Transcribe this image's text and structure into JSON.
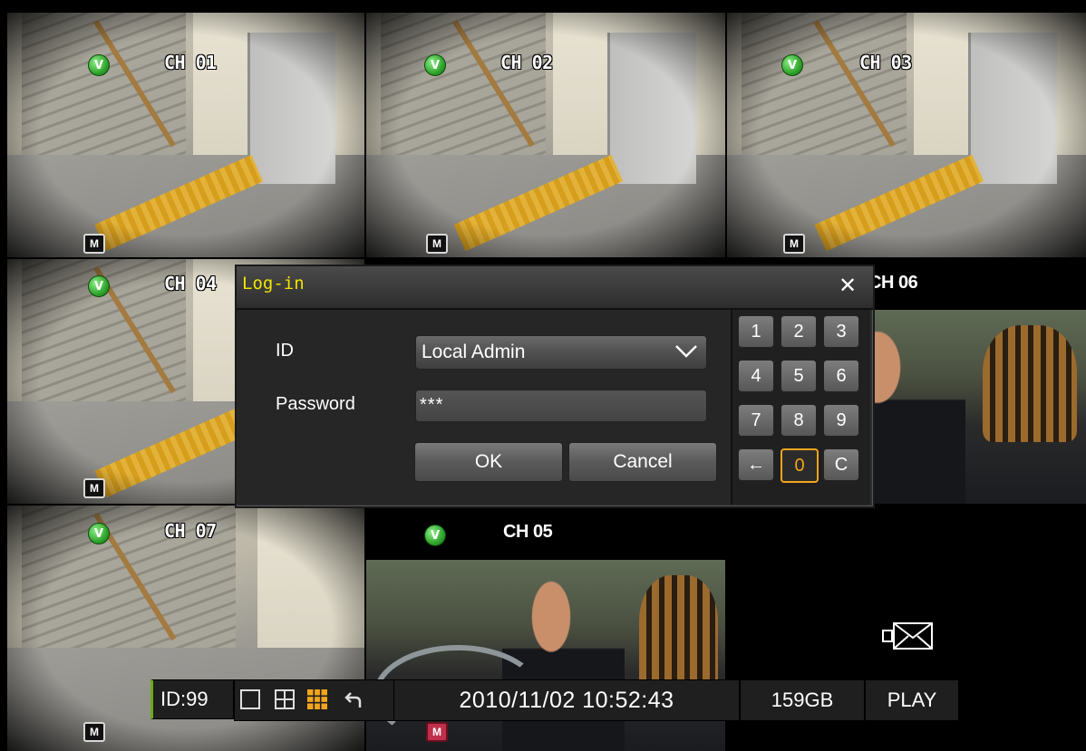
{
  "cameras": [
    {
      "channel": "CH 01"
    },
    {
      "channel": "CH 02"
    },
    {
      "channel": "CH 03"
    },
    {
      "channel": "CH 04"
    },
    {
      "channel": "CH 06"
    },
    {
      "channel": "CH 07"
    },
    {
      "channel": "CH 05"
    }
  ],
  "icons": {
    "status": "V",
    "motion": "M",
    "no_video": "no-video-icon"
  },
  "dialog": {
    "title": "Log-in",
    "id_label": "ID",
    "id_value": "Local Admin",
    "password_label": "Password",
    "password_value": "***",
    "ok_label": "OK",
    "cancel_label": "Cancel",
    "keypad": [
      "1",
      "2",
      "3",
      "4",
      "5",
      "6",
      "7",
      "8",
      "9",
      "←",
      "0",
      "C"
    ],
    "active_key": "0"
  },
  "status_bar": {
    "id": "ID:99",
    "datetime": "2010/11/02 10:52:43",
    "storage": "159GB",
    "mode": "PLAY"
  },
  "colors": {
    "title_yellow": "#f0e400",
    "accent_orange": "#f4a51c",
    "status_green": "#2fa42b",
    "motion_red": "#c0304a"
  }
}
